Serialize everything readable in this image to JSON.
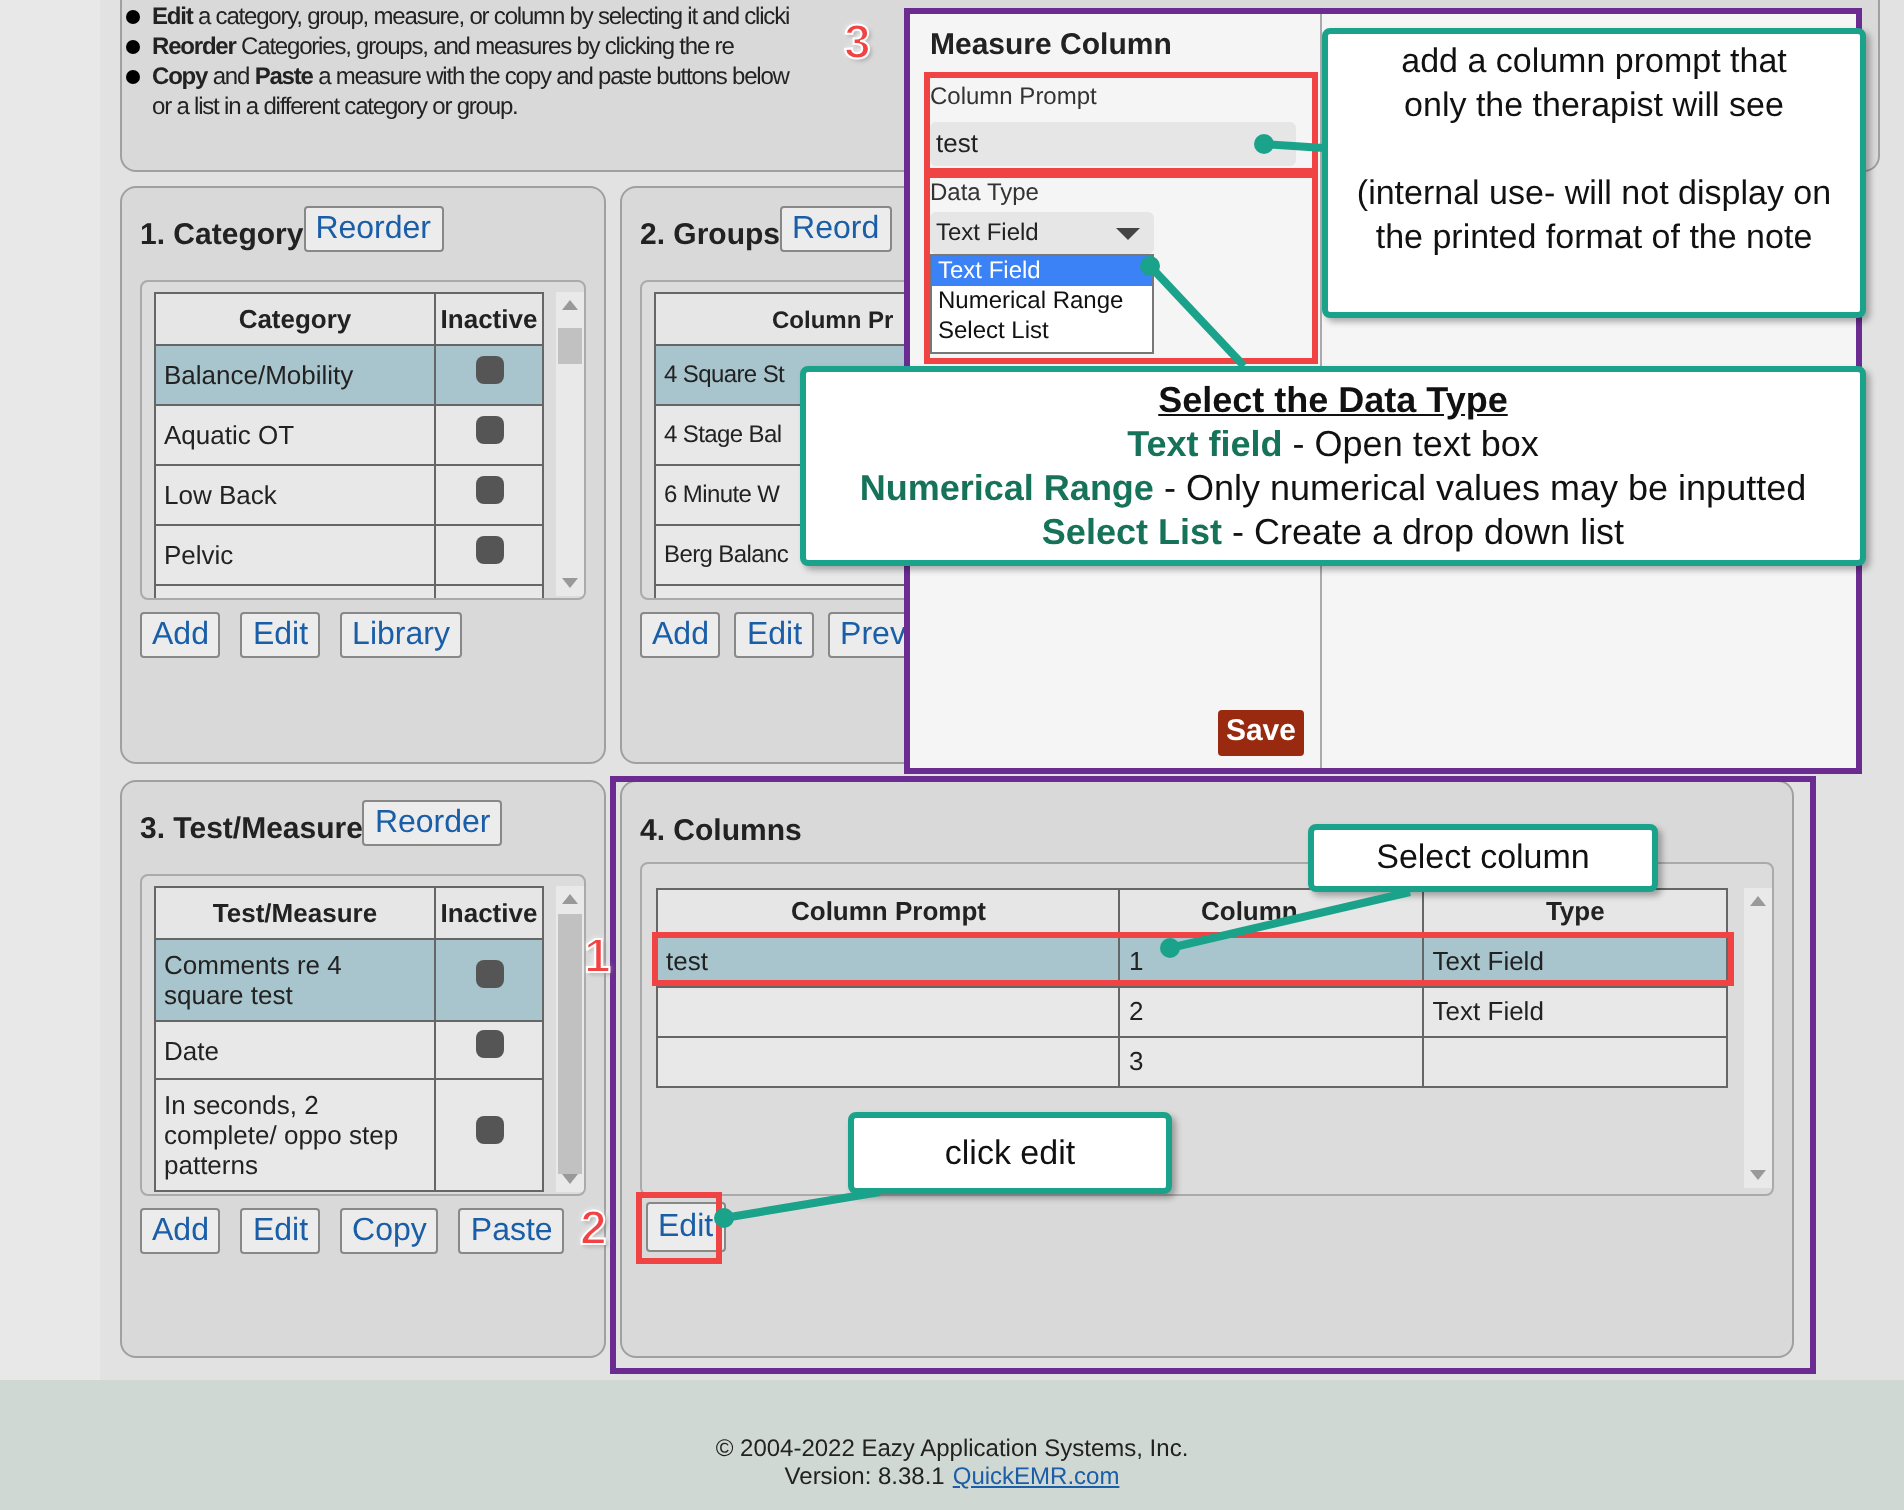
{
  "instructions": [
    {
      "text": "**Edit** a category, group, measure, or column by selecting it and clicki"
    },
    {
      "text": "**Reorder** Categories, groups, and measures by clicking the re"
    },
    {
      "text": "**Copy** and **Paste** a measure with the copy and paste buttons below or a list in a different category or group."
    }
  ],
  "category_panel": {
    "title": "1. Category",
    "reorder": "Reorder",
    "columns": [
      "Category",
      "Inactive"
    ],
    "rows": [
      {
        "name": "Balance/Mobility",
        "selected": true
      },
      {
        "name": "Aquatic OT",
        "selected": false
      },
      {
        "name": "Low Back",
        "selected": false
      },
      {
        "name": "Pelvic",
        "selected": false
      }
    ],
    "buttons": [
      "Add",
      "Edit",
      "Library"
    ]
  },
  "groups_panel": {
    "title": "2. Groups",
    "reorder": "Reord",
    "columns": [
      "Column Pr"
    ],
    "rows": [
      {
        "name": "4 Square St",
        "selected": true
      },
      {
        "name": "4 Stage Bal",
        "selected": false
      },
      {
        "name": "6 Minute W",
        "selected": false
      },
      {
        "name": "Berg Balanc",
        "selected": false
      }
    ],
    "buttons": [
      "Add",
      "Edit",
      "Prev"
    ]
  },
  "measure_panel": {
    "title": "3. Test/Measure",
    "reorder": "Reorder",
    "columns": [
      "Test/Measure",
      "Inactive"
    ],
    "rows": [
      {
        "name": "Comments re 4 square test",
        "selected": true
      },
      {
        "name": "Date",
        "selected": false
      },
      {
        "name": "In seconds, 2 complete/ oppo step patterns",
        "selected": false
      }
    ],
    "buttons": [
      "Add",
      "Edit",
      "Copy",
      "Paste"
    ]
  },
  "columns_panel": {
    "title": "4. Columns",
    "columns": [
      "Column Prompt",
      "Column",
      "Type"
    ],
    "rows": [
      {
        "prompt": "test",
        "column": "1",
        "type": "Text Field",
        "selected": true
      },
      {
        "column": "2",
        "type": "Text Field",
        "selected": false
      },
      {
        "column": "3",
        "selected": false
      }
    ],
    "edit": "Edit"
  },
  "modal": {
    "title": "Measure Column",
    "prompt_label": "Column Prompt",
    "prompt_value": "test",
    "type_label": "Data Type",
    "type_value": "Text Field",
    "options": [
      {
        "label": "Text Field",
        "selected": true
      },
      {
        "label": "Numerical Range",
        "selected": false
      },
      {
        "label": "Select List",
        "selected": false
      }
    ],
    "save": "Save"
  },
  "prompt_note": {
    "text": "add a column prompt that only the therapist will see",
    "detail": "(internal use- will not display on the printed format of the note"
  },
  "type_note": {
    "heading": "Select the Data Type",
    "lines": [
      "**Text field** - Open text box",
      "**Numerical Range** - Only numerical values may be inputted",
      "**Select List** - Create a drop down list"
    ]
  },
  "column_note": "Select column",
  "edit_note": "click edit",
  "steps": [
    "3",
    "1",
    "2"
  ],
  "footer": {
    "copyright": "© 2004-2022 Eazy Application Systems, Inc.",
    "version": "Version: 8.38.1",
    "link": "QuickEMR.com"
  }
}
